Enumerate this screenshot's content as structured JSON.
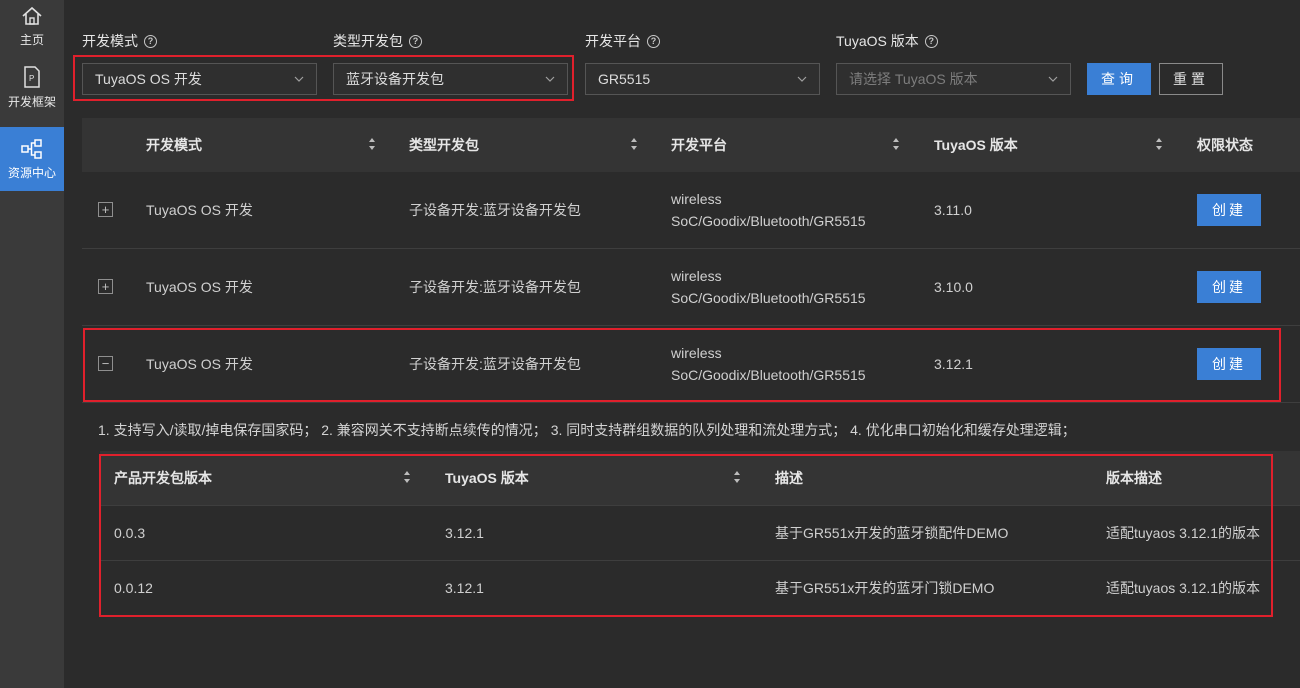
{
  "sidebar": {
    "items": [
      {
        "label": "主页",
        "icon": "home-icon"
      },
      {
        "label": "开发框架",
        "icon": "document-icon"
      },
      {
        "label": "资源中心",
        "icon": "resource-nodes-icon",
        "active": true
      }
    ]
  },
  "filters": {
    "mode": {
      "label": "开发模式",
      "value": "TuyaOS OS 开发"
    },
    "package": {
      "label": "类型开发包",
      "value": "蓝牙设备开发包"
    },
    "platform": {
      "label": "开发平台",
      "value": "GR5515"
    },
    "version": {
      "label": "TuyaOS 版本",
      "placeholder": "请选择 TuyaOS 版本"
    },
    "query_label": "查询",
    "reset_label": "重置"
  },
  "table": {
    "headers": [
      "开发模式",
      "类型开发包",
      "开发平台",
      "TuyaOS 版本",
      "权限状态"
    ],
    "rows": [
      {
        "mode": "TuyaOS OS 开发",
        "package": "子设备开发:蓝牙设备开发包",
        "platform_line1": "wireless",
        "platform_line2": "SoC/Goodix/Bluetooth/GR5515",
        "version": "3.11.0",
        "action": "创建",
        "expanded": false,
        "toggle": "+"
      },
      {
        "mode": "TuyaOS OS 开发",
        "package": "子设备开发:蓝牙设备开发包",
        "platform_line1": "wireless",
        "platform_line2": "SoC/Goodix/Bluetooth/GR5515",
        "version": "3.10.0",
        "action": "创建",
        "expanded": false,
        "toggle": "+"
      },
      {
        "mode": "TuyaOS OS 开发",
        "package": "子设备开发:蓝牙设备开发包",
        "platform_line1": "wireless",
        "platform_line2": "SoC/Goodix/Bluetooth/GR5515",
        "version": "3.12.1",
        "action": "创建",
        "expanded": true,
        "toggle": "−"
      }
    ]
  },
  "expanded_description": "1. 支持写入/读取/掉电保存国家码； 2. 兼容网关不支持断点续传的情况； 3. 同时支持群组数据的队列处理和流处理方式； 4. 优化串口初始化和缓存处理逻辑；",
  "sub_table": {
    "headers": [
      "产品开发包版本",
      "TuyaOS 版本",
      "描述",
      "版本描述"
    ],
    "rows": [
      {
        "pkg_version": "0.0.3",
        "os_version": "3.12.1",
        "desc": "基于GR551x开发的蓝牙锁配件DEMO",
        "version_desc": "适配tuyaos 3.12.1的版本"
      },
      {
        "pkg_version": "0.0.12",
        "os_version": "3.12.1",
        "desc": "基于GR551x开发的蓝牙门锁DEMO",
        "version_desc": "适配tuyaos 3.12.1的版本"
      }
    ]
  },
  "colors": {
    "accent": "#3a7fd5",
    "highlight_border": "#e0202c",
    "background": "#2b2b2b"
  }
}
